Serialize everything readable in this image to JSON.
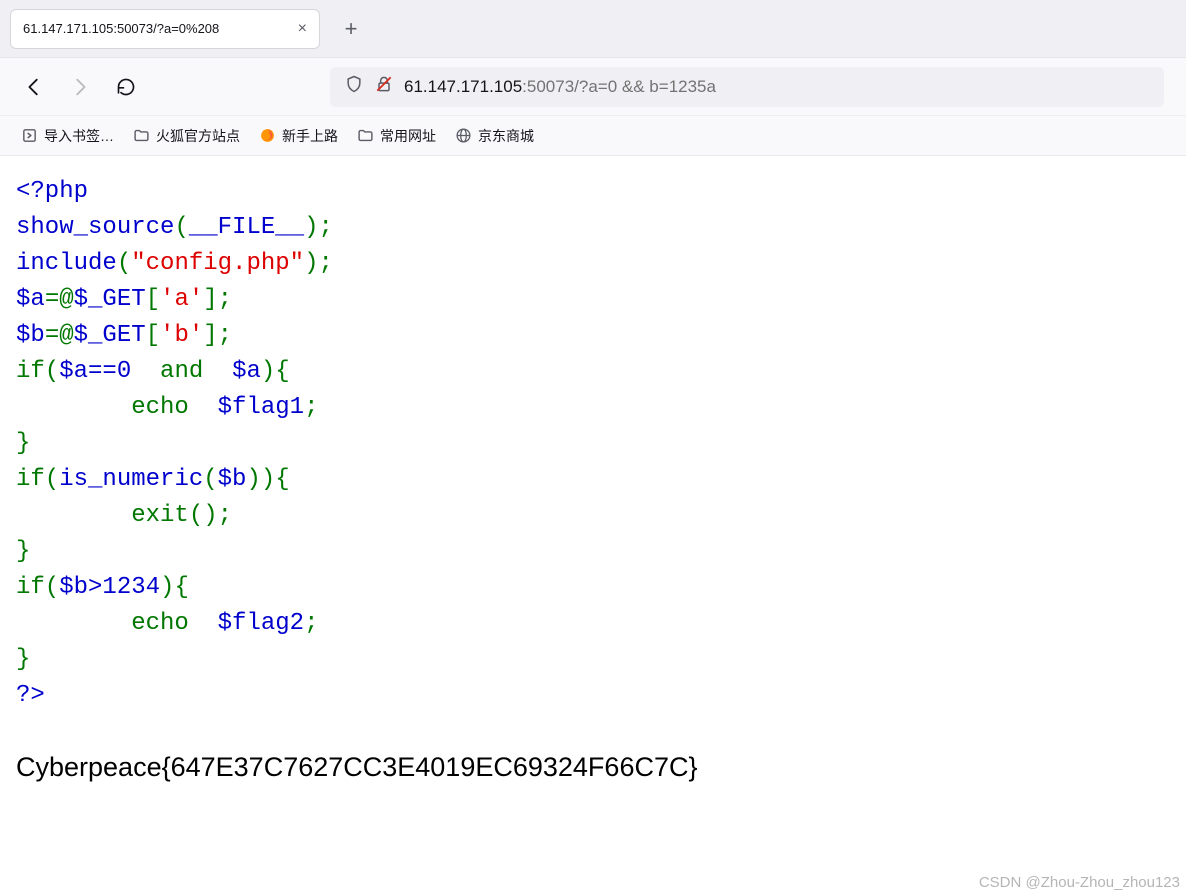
{
  "tab": {
    "title": "61.147.171.105:50073/?a=0%208",
    "close_label": "×",
    "new_tab_label": "+"
  },
  "url": {
    "host": "61.147.171.105",
    "rest": ":50073/?a=0 && b=1235a"
  },
  "bookmarks": {
    "import_label": "导入书签…",
    "firefox_official": "火狐官方站点",
    "getting_started": "新手上路",
    "common_urls": "常用网址",
    "jd": "京东商城"
  },
  "code": {
    "open_tag": "<?php",
    "show_source_fn": "show_source",
    "lparen": "(",
    "file_const": "__FILE__",
    "rparen_semi": ");",
    "include_fn": "include",
    "config_str": "\"config.php\"",
    "var_a": "$a",
    "eq_at": "=@",
    "get": "$_GET",
    "lbr": "[",
    "a_key": "'a'",
    "b_key": "'b'",
    "rbr_semi": "];",
    "var_b": "$b",
    "if_kw": "if(",
    "if_cond_a_cmp": "$a==0",
    "and_kw": "and",
    "close_paren_brace": "){",
    "echo_kw": "echo",
    "flag1": "$flag1",
    "semi": ";",
    "rbrace": "}",
    "is_numeric": "is_numeric",
    "exit_kw": "exit",
    "empty_parens_semi": "();",
    "cond_b": "$b>1234",
    "flag2": "$flag2",
    "close_tag": "?>"
  },
  "output": {
    "flag": "Cyberpeace{647E37C7627CC3E4019EC69324F66C7C}"
  },
  "watermark": "CSDN @Zhou-Zhou_zhou123"
}
